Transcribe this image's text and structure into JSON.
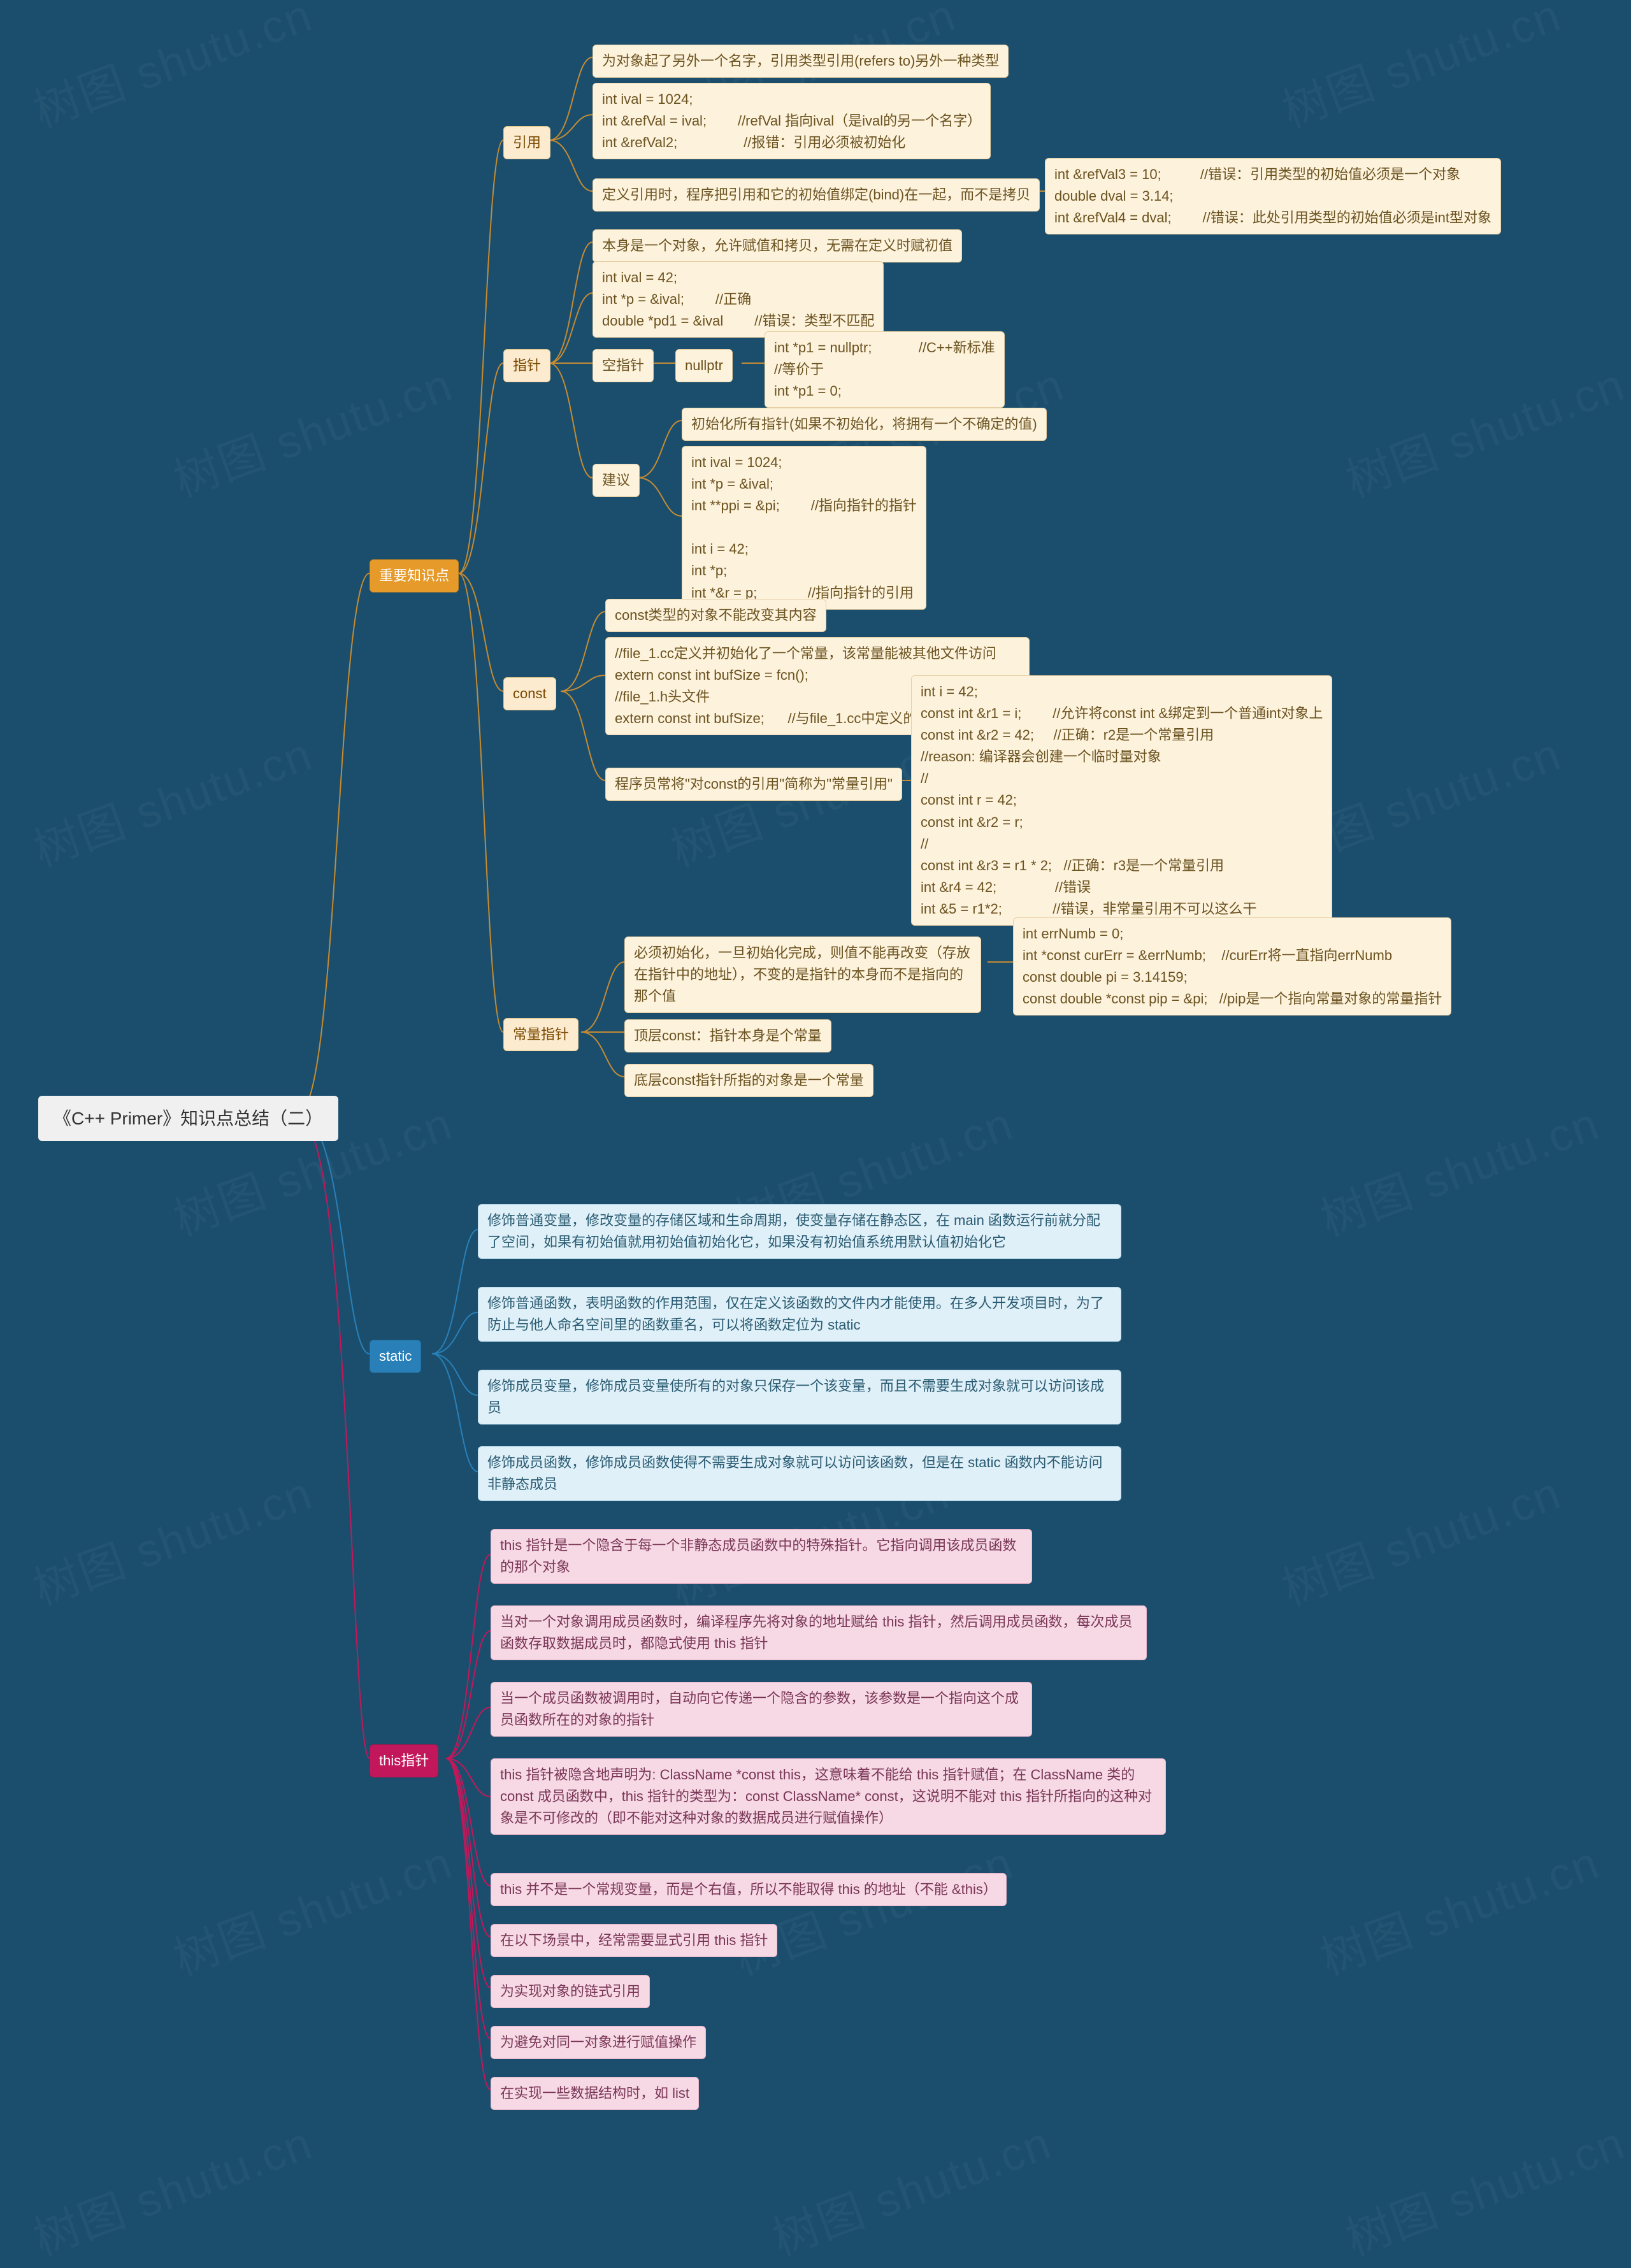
{
  "watermark": "树图 shutu.cn",
  "root": "《C++ Primer》知识点总结（二）",
  "branches": {
    "key": "重要知识点",
    "static": "static",
    "this": "this指针"
  },
  "ref": {
    "name": "引用",
    "a": "为对象起了另外一个名字，引用类型引用(refers to)另外一种类型",
    "b": "int ival = 1024;\nint &refVal = ival;        //refVal 指向ival（是ival的另一个名字）\nint &refVal2;                 //报错：引用必须被初始化",
    "c": "定义引用时，程序把引用和它的初始值绑定(bind)在一起，而不是拷贝",
    "d": "int &refVal3 = 10;          //错误：引用类型的初始值必须是一个对象\ndouble dval = 3.14;\nint &refVal4 = dval;        //错误：此处引用类型的初始值必须是int型对象"
  },
  "ptr": {
    "name": "指针",
    "a": "本身是一个对象，允许赋值和拷贝，无需在定义时赋初值",
    "b": "int ival = 42;\nint *p = &ival;        //正确\ndouble *pd1 = &ival        //错误：类型不匹配",
    "null": "空指针",
    "nullptr": "nullptr",
    "nullbody": "int *p1 = nullptr;            //C++新标准\n//等价于\nint *p1 = 0;",
    "advice": "建议",
    "adv1": "初始化所有指针(如果不初始化，将拥有一个不确定的值)",
    "adv2": "int ival = 1024;\nint *p = &ival;\nint **ppi = &pi;        //指向指针的指针\n\nint i = 42;\nint *p;\nint *&r = p;             //指向指针的引用"
  },
  "cst": {
    "name": "const",
    "a": "const类型的对象不能改变其内容",
    "b": "//file_1.cc定义并初始化了一个常量，该常量能被其他文件访问\nextern const int bufSize = fcn();\n//file_1.h头文件\nextern const int bufSize;      //与file_1.cc中定义的bufSize是同一个",
    "c": "程序员常将\"对const的引用\"简称为\"常量引用\"",
    "d": "int i = 42;\nconst int &r1 = i;        //允许将const int &绑定到一个普通int对象上\nconst int &r2 = 42;     //正确：r2是一个常量引用\n//reason: 编译器会创建一个临时量对象\n//\nconst int r = 42;\nconst int &r2 = r;\n//\nconst int &r3 = r1 * 2;   //正确：r3是一个常量引用\nint &r4 = 42;               //错误\nint &5 = r1*2;             //错误，非常量引用不可以这么干"
  },
  "cptr": {
    "name": "常量指针",
    "a": "必须初始化，一旦初始化完成，则值不能再改变（存放在指针中的地址），不变的是指针的本身而不是指向的那个值",
    "a2": "int errNumb = 0;\nint *const curErr = &errNumb;    //curErr将一直指向errNumb\nconst double pi = 3.14159;\nconst double *const pip = &pi;   //pip是一个指向常量对象的常量指针",
    "b": "顶层const：指针本身是个常量",
    "c": "底层const指针所指的对象是一个常量"
  },
  "stat": {
    "a": "修饰普通变量，修改变量的存储区域和生命周期，使变量存储在静态区，在 main 函数运行前就分配了空间，如果有初始值就用初始值初始化它，如果没有初始值系统用默认值初始化它",
    "b": "修饰普通函数，表明函数的作用范围，仅在定义该函数的文件内才能使用。在多人开发项目时，为了防止与他人命名空间里的函数重名，可以将函数定位为 static",
    "c": "修饰成员变量，修饰成员变量使所有的对象只保存一个该变量，而且不需要生成对象就可以访问该成员",
    "d": "修饰成员函数，修饰成员函数使得不需要生成对象就可以访问该函数，但是在 static 函数内不能访问非静态成员"
  },
  "this": {
    "a": "this 指针是一个隐含于每一个非静态成员函数中的特殊指针。它指向调用该成员函数的那个对象",
    "b": "当对一个对象调用成员函数时，编译程序先将对象的地址赋给 this 指针，然后调用成员函数，每次成员函数存取数据成员时，都隐式使用 this 指针",
    "c": "当一个成员函数被调用时，自动向它传递一个隐含的参数，该参数是一个指向这个成员函数所在的对象的指针",
    "d": "this 指针被隐含地声明为: ClassName *const this，这意味着不能给 this 指针赋值；在 ClassName 类的 const 成员函数中，this 指针的类型为：const ClassName* const，这说明不能对 this 指针所指向的这种对象是不可修改的（即不能对这种对象的数据成员进行赋值操作）",
    "e": "this 并不是一个常规变量，而是个右值，所以不能取得 this 的地址（不能 &this）",
    "f": "在以下场景中，经常需要显式引用 this 指针",
    "g": "为实现对象的链式引用",
    "h": "为避免对同一对象进行赋值操作",
    "i": "在实现一些数据结构时，如 list"
  }
}
